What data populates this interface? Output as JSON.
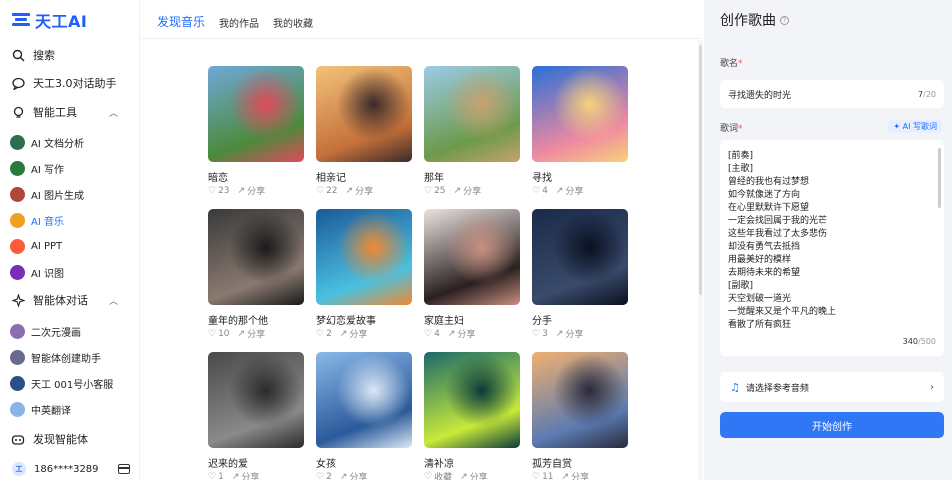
{
  "brand": {
    "logo_text": "天工AI"
  },
  "sidebar": {
    "items": [
      {
        "label": "搜索",
        "icon": "search-icon"
      },
      {
        "label": "天工3.0对话助手",
        "icon": "chat-bubble-icon"
      }
    ],
    "tools_section": {
      "label": "智能工具",
      "icon": "bulb-icon"
    },
    "tools": [
      {
        "label": "AI 文档分析",
        "color": "#2a6f4e"
      },
      {
        "label": "AI 写作",
        "color": "#2a7a3c"
      },
      {
        "label": "AI 图片生成",
        "color": "#b0453a"
      },
      {
        "label": "AI 音乐",
        "color": "#f0a020"
      },
      {
        "label": "AI PPT",
        "color": "#ff5a3c"
      },
      {
        "label": "AI 识图",
        "color": "#7a2db8"
      }
    ],
    "agents_section": {
      "label": "智能体对话",
      "icon": "sparkle-icon"
    },
    "agents": [
      {
        "label": "二次元漫画",
        "color": "#8a6fb0"
      },
      {
        "label": "智能体创建助手",
        "color": "#6a6a8a"
      },
      {
        "label": "天工 001号小客服",
        "color": "#2a4f8a"
      },
      {
        "label": "中英翻译",
        "color": "#8ab4e8"
      }
    ],
    "discover": {
      "label": "发现智能体",
      "icon": "robot-icon"
    },
    "user": {
      "phone": "186****3289"
    }
  },
  "tabs": [
    {
      "label": "发现音乐",
      "active": true
    },
    {
      "label": "我的作品",
      "active": false
    },
    {
      "label": "我的收藏",
      "active": false
    }
  ],
  "songs": [
    {
      "title": "暗恋",
      "likes": "23",
      "share": "分享",
      "colors": [
        "#6fa8d8",
        "#4c8a3c",
        "#e04a5a"
      ]
    },
    {
      "title": "相亲记",
      "likes": "22",
      "share": "分享",
      "colors": [
        "#f2c27a",
        "#c4703a",
        "#3a2a2a"
      ]
    },
    {
      "title": "那年",
      "likes": "25",
      "share": "分享",
      "colors": [
        "#9ccbe8",
        "#6c9a4a",
        "#c8a070"
      ]
    },
    {
      "title": "寻找",
      "likes": "4",
      "share": "分享",
      "colors": [
        "#2a6fd8",
        "#f08aa0",
        "#f6d27a"
      ]
    },
    {
      "title": "童年的那个他",
      "likes": "10",
      "share": "分享",
      "colors": [
        "#3a3a3a",
        "#8a7a70",
        "#1a1a1a"
      ]
    },
    {
      "title": "梦幻恋爱故事",
      "likes": "2",
      "share": "分享",
      "colors": [
        "#1a5a9a",
        "#4ac0e0",
        "#f08a30"
      ]
    },
    {
      "title": "家庭主妇",
      "likes": "4",
      "share": "分享",
      "colors": [
        "#eae4e0",
        "#2a2020",
        "#c89080"
      ]
    },
    {
      "title": "分手",
      "likes": "3",
      "share": "分享",
      "colors": [
        "#1a2a4a",
        "#3a4a6a",
        "#0a1020"
      ]
    },
    {
      "title": "迟来的爱",
      "likes": "1",
      "share": "分享",
      "colors": [
        "#4a4a4a",
        "#8a8a8a",
        "#2a2a2a"
      ]
    },
    {
      "title": "女孩",
      "likes": "2",
      "share": "分享",
      "colors": [
        "#8ab8e8",
        "#2a5a9a",
        "#dde8f4"
      ]
    },
    {
      "title": "清补凉",
      "likes": "收藏",
      "share": "分享",
      "colors": [
        "#1a6a6a",
        "#c8ea3a",
        "#0a3a3a"
      ]
    },
    {
      "title": "孤芳自赏",
      "likes": "11",
      "share": "分享",
      "colors": [
        "#f0b070",
        "#5a7ab0",
        "#2a2a3a"
      ]
    }
  ],
  "panel": {
    "title": "创作歌曲",
    "song_name_label": "歌名",
    "song_name_value": "寻找遗失的时光",
    "song_name_count": "7",
    "song_name_max": "/20",
    "lyrics_label": "歌词",
    "ai_write_label": "✦ AI 写歌词",
    "lyrics_lines": [
      "[前奏]",
      "[主歌]",
      "曾经的我也有过梦想",
      "如今就像迷了方向",
      "在心里默默许下愿望",
      "一定会找回属于我的光芒",
      "这些年我看过了太多悲伤",
      "却没有勇气去抵挡",
      "用最美好的模样",
      "去期待未来的希望",
      "[副歌]",
      "天空划破一道光",
      "一觉醒来又是个平凡的晚上",
      "看散了所有疯狂"
    ],
    "lyrics_count": "340",
    "lyrics_max": "/500",
    "ref_audio_label": "请选择参考音频",
    "start_button": "开始创作",
    "accent": "#2f77f5"
  }
}
